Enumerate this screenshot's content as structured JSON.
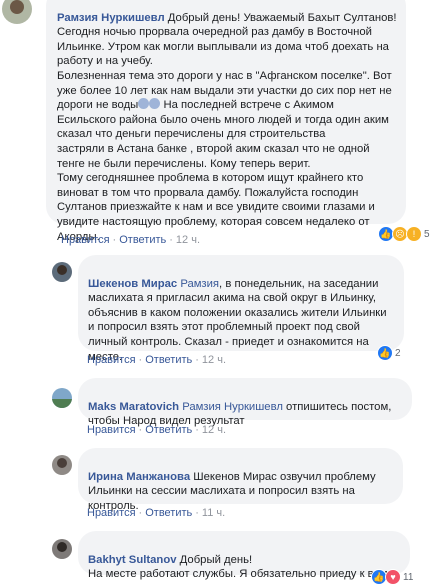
{
  "comments": [
    {
      "author": "Рамзия Нуркишевл",
      "lines": [
        "Добрый день! Уважаемый Бахыт Султанов!",
        "Сегодня ночью прорвала очередной раз дамбу в Восточной",
        "Ильинке. Утром как могли выплывали из дома чтоб доехать на",
        "работу и на учебу.",
        "Болезненная тема это дороги у нас в \"Афганском поселке\". Вот",
        "уже более 10 лет как нам выдали эти участки до сих пор нет не",
        "дороги не воды",
        "На последней встрече с Акимом",
        "Есильского района было очень много людей и тогда один аким",
        "сказал что деньги перечислены для строительства",
        "застряли в Астана банке , второй аким сказал что не одной",
        "тенге не были перечислены. Кому теперь верит.",
        "Тому сегодняшнее проблема в котором ищут крайнего кто",
        "виноват в том что прорвала дамбу. Пожалуйста господин",
        "Султанов приезжайте к нам и все увидите своими глазами и",
        "увидите настоящую проблему, которая совсем недалеко от",
        "Акорды."
      ],
      "like_label": "Нравится",
      "reply_label": "Ответить",
      "time": "12 ч.",
      "reaction_count": "5",
      "reactions": [
        "like-icon",
        "sad-icon",
        "wow-icon"
      ]
    },
    {
      "author": "Шекенов Мирас",
      "mention": "Рамзия",
      "lines": [
        ", в понедельник, на заседании",
        "маслихата я пригласил акима на свой округ в Ильинку,",
        "объяснив в каком положении оказались жители Ильинки",
        "и попросил взять этот проблемный проект под свой",
        "личный контроль. Сказал - приедет и ознакомится на",
        "месте."
      ],
      "like_label": "Нравится",
      "reply_label": "Ответить",
      "time": "12 ч.",
      "reaction_count": "2",
      "reactions": [
        "like-icon"
      ]
    },
    {
      "author": "Maks Maratovich",
      "mention": "Рамзия Нуркишевл",
      "lines": [
        " отпишитесь постом,",
        "чтобы Народ видел результат"
      ],
      "like_label": "Нравится",
      "reply_label": "Ответить",
      "time": "12 ч."
    },
    {
      "author": "Ирина Манжанова",
      "lines": [
        " Шекенов Мирас озвучил проблему",
        "Ильинки на сессии маслихата и попросил взять на",
        "контроль."
      ],
      "like_label": "Нравится",
      "reply_label": "Ответить",
      "time": "11 ч."
    },
    {
      "author": "Bakhyt Sultanov",
      "lines": [
        " Добрый день!",
        "На месте работают службы. Я обязательно приеду к вам"
      ],
      "reaction_count": "11",
      "reactions": [
        "like-icon",
        "love-icon"
      ]
    }
  ]
}
